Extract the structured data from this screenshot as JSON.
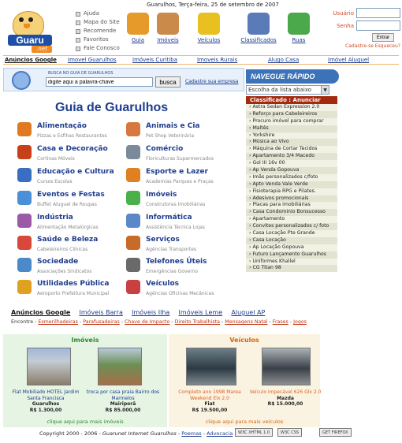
{
  "header": {
    "date": "Guarulhos, Terça-feira, 25 de setembro de 2007",
    "logo": {
      "word": "Guaru",
      "suffix": ".net"
    },
    "top_links": [
      "Ajuda",
      "Mapa do Site",
      "Recomende",
      "Favoritos",
      "Fale Conosco"
    ],
    "categories": [
      {
        "label": "Guia",
        "icon": "guide-icon",
        "color": "#e69a2a"
      },
      {
        "label": "Imóveis",
        "icon": "house-icon",
        "color": "#c98a4a"
      },
      {
        "label": "Veículos",
        "icon": "car-icon",
        "color": "#e8c020"
      },
      {
        "label": "Classificados",
        "icon": "classified-icon",
        "color": "#5a7ab8"
      },
      {
        "label": "Ruas",
        "icon": "street-icon",
        "color": "#4ba84b"
      }
    ],
    "login": {
      "user_label": "Usuário",
      "pass_label": "Senha",
      "button": "Entrar",
      "forgot": "Cadastre-se Esqueceu?"
    }
  },
  "link_strip": {
    "first": "Anúncios Google",
    "links": [
      "Imovel Guarulhos",
      "Imóveis Curitiba",
      "Imoveis Rurais",
      "Alugo Casa",
      "Imóvel Aluguel"
    ]
  },
  "search": {
    "title": "BUSCA NO GUIA DE GUARULHOS",
    "value": "digite aqui a palavra-chave",
    "button": "busca",
    "register": "Cadastre sua empresa"
  },
  "navegue": {
    "title": "NAVEGUE RÁPIDO",
    "select": "Escolha da lista abaixo"
  },
  "guia": {
    "title": "Guia de Guarulhos",
    "left": [
      {
        "t": "Alimentação",
        "s": "Pizzas e Esfihas Restaurantes",
        "c": "#e07a20"
      },
      {
        "t": "Casa e Decoração",
        "s": "Cortinas Móveis",
        "c": "#c8401a"
      },
      {
        "t": "Educação e Cultura",
        "s": "Cursos Escolas",
        "c": "#3a6ec2"
      },
      {
        "t": "Eventos e Festas",
        "s": "Buffet Aluguel de Roupas",
        "c": "#4a90d8"
      },
      {
        "t": "Indústria",
        "s": "Alimentação Metalúrgicas",
        "c": "#9a5aa8"
      },
      {
        "t": "Saúde e Beleza",
        "s": "Cabeleireiros Clínicas",
        "c": "#d8483a"
      },
      {
        "t": "Sociedade",
        "s": "Associações Sindicatos",
        "c": "#4a8ac8"
      },
      {
        "t": "Utilidades Pública",
        "s": "Aeroporto Prefeitura Municipal",
        "c": "#e0a020"
      }
    ],
    "right": [
      {
        "t": "Animais e Cia",
        "s": "Pet Shop Veterinária",
        "c": "#d87840"
      },
      {
        "t": "Comércio",
        "s": "Floriculturas Supermercados",
        "c": "#7a8a9a"
      },
      {
        "t": "Esporte e Lazer",
        "s": "Academias Parques e Praças",
        "c": "#e08020"
      },
      {
        "t": "Imóveis",
        "s": "Construtoras Imobiliárias",
        "c": "#4ab04a"
      },
      {
        "t": "Informática",
        "s": "Assistência Técnica Lojas",
        "c": "#5a88c8"
      },
      {
        "t": "Serviços",
        "s": "Agências Transportes",
        "c": "#c86a28"
      },
      {
        "t": "Telefones Úteis",
        "s": "Emergências Governo",
        "c": "#6a6a6a"
      },
      {
        "t": "Veículos",
        "s": "Agências Oficinas Mecânicas",
        "c": "#c84040"
      }
    ]
  },
  "classified": {
    "title": "Classificado : Anunciar Grátis",
    "items": [
      "Astra Sedan Expression 2.0",
      "Reforço para Cabeleireiros",
      "Procuro imóvel para comprar",
      "Maltês",
      "Yorkshire",
      "Música ao Vivo",
      "Máquina de Cortar Tecidos",
      "Apartamento 3/4 Macedo",
      "Gol III 16v 00",
      "Ap Venda Gopouva",
      "Imãs personalizados c/foto",
      "Apto Venda Vale Verde",
      "Fisioterapia RPG e Pilates.",
      "Adesivos promocionais",
      "Placas para imobiliárias",
      "Casa Condominio Bonsucesso",
      "Apartamento",
      "Convites personalizados c/ foto",
      "Casa Locação Pte Grande",
      "Casa Locação",
      "Ap Locação Gopouva",
      "Futuro Lançamento Guarulhos",
      "Uniformes Khallel",
      "CG Titan 98"
    ]
  },
  "bottom_nav": {
    "first": "Anúncios Google",
    "links": [
      "Imóveis Barra",
      "Imóveis Ilha",
      "Imóveis Leme",
      "Aluguel AP"
    ],
    "encontre_label": "Encontre -",
    "encontre": [
      "Esmerilhadeiras",
      "Parafusadeiras",
      "Chave de Impacto",
      "Direito Trabalhista",
      "Mensagens Natal",
      "Frases",
      "Jogos"
    ]
  },
  "imoveis": {
    "title": "Imóveis",
    "items": [
      {
        "desc": "Flat Mobiliado HOTEL Jardim Santa Francisca",
        "city": "Guarulhos",
        "price": "R$ 1.300,00"
      },
      {
        "desc": "troca por casa praia Bairro dos Marmelos",
        "city": "Mairiporã",
        "price": "R$ 85.000,00"
      }
    ],
    "more": "clique aqui para mais imóveis"
  },
  "veiculos": {
    "title": "Veículos",
    "items": [
      {
        "desc": "Completo ano 1998 Marea Weekend Elx 2.0",
        "city": "Fiat",
        "price": "R$ 19.500,00"
      },
      {
        "desc": "Veículo impecável 626 Glx 2.0",
        "city": "Mazda",
        "price": "R$ 15.000,00"
      }
    ],
    "more": "clique aqui para mais veículos"
  },
  "footer": {
    "copyright": "Copyright 2000 - 2006 - ",
    "brand": "Guarunet Internet Guarulhos",
    "links": [
      "Poemas",
      "Advocacia"
    ],
    "badges": [
      "W3C XHTML 1.0",
      "W3C CSS",
      "GET FIREFOX"
    ]
  }
}
